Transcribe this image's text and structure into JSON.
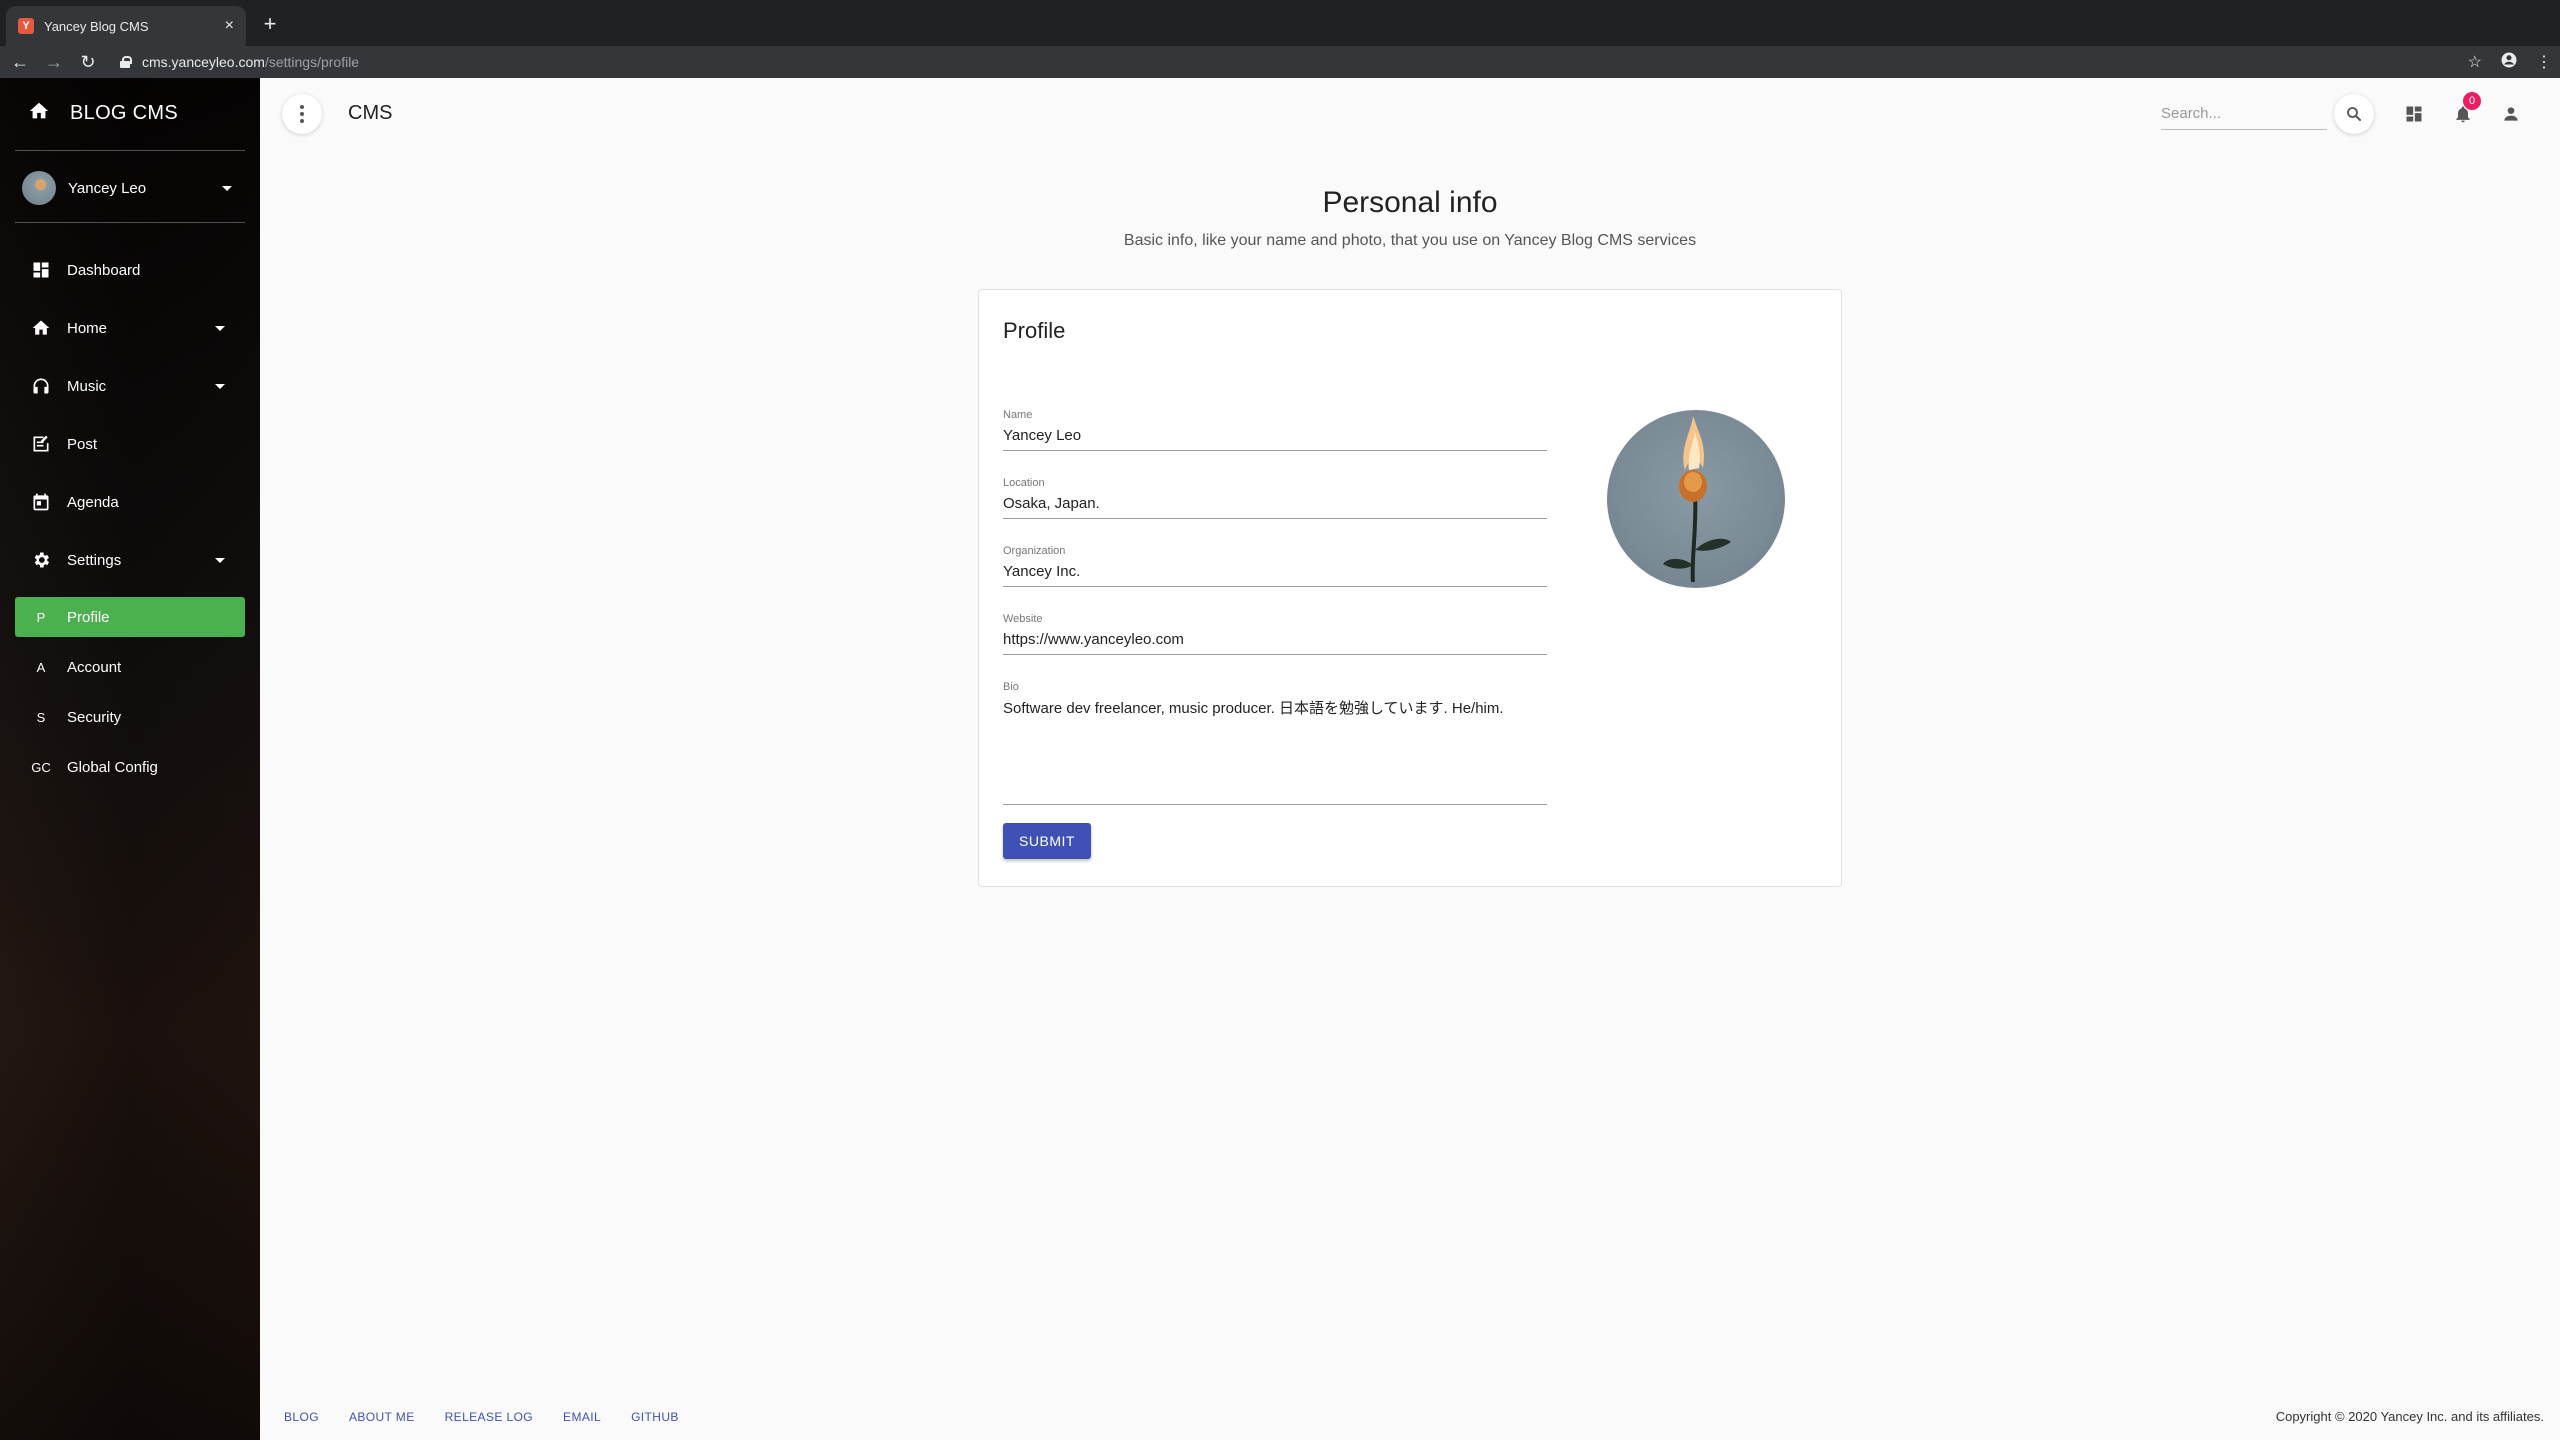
{
  "browser": {
    "tab_title": "Yancey Blog CMS",
    "tab_close": "×",
    "new_tab": "+",
    "url_host": "cms.yanceyleo.com",
    "url_path": "/settings/profile"
  },
  "sidebar": {
    "brand": "BLOG CMS",
    "user_name": "Yancey Leo",
    "nav": [
      {
        "label": "Dashboard",
        "icon": "dashboard-icon"
      },
      {
        "label": "Home",
        "icon": "home-icon"
      },
      {
        "label": "Music",
        "icon": "headphones-icon"
      },
      {
        "label": "Post",
        "icon": "post-icon"
      },
      {
        "label": "Agenda",
        "icon": "calendar-icon"
      },
      {
        "label": "Settings",
        "icon": "gear-icon"
      }
    ],
    "sub_nav": [
      {
        "abbr": "P",
        "label": "Profile"
      },
      {
        "abbr": "A",
        "label": "Account"
      },
      {
        "abbr": "S",
        "label": "Security"
      },
      {
        "abbr": "GC",
        "label": "Global Config"
      }
    ],
    "active_color": "#4caf50"
  },
  "appbar": {
    "title": "CMS",
    "search_placeholder": "Search...",
    "notification_count": "0"
  },
  "main": {
    "title": "Personal info",
    "subtitle": "Basic info, like your name and photo, that you use on Yancey Blog CMS services",
    "card_title": "Profile",
    "fields": {
      "name": {
        "label": "Name",
        "value": "Yancey Leo"
      },
      "location": {
        "label": "Location",
        "value": "Osaka, Japan."
      },
      "organization": {
        "label": "Organization",
        "value": "Yancey Inc."
      },
      "website": {
        "label": "Website",
        "value": "https://www.yanceyleo.com"
      },
      "bio": {
        "label": "Bio",
        "value": "Software dev freelancer, music producer. 日本語を勉強しています. He/him."
      }
    },
    "submit_label": "SUBMIT",
    "primary_color": "#3f51b5"
  },
  "footer": {
    "links": [
      "BLOG",
      "ABOUT ME",
      "RELEASE LOG",
      "EMAIL",
      "GITHUB"
    ],
    "copyright": "Copyright © 2020 Yancey Inc. and its affiliates."
  }
}
